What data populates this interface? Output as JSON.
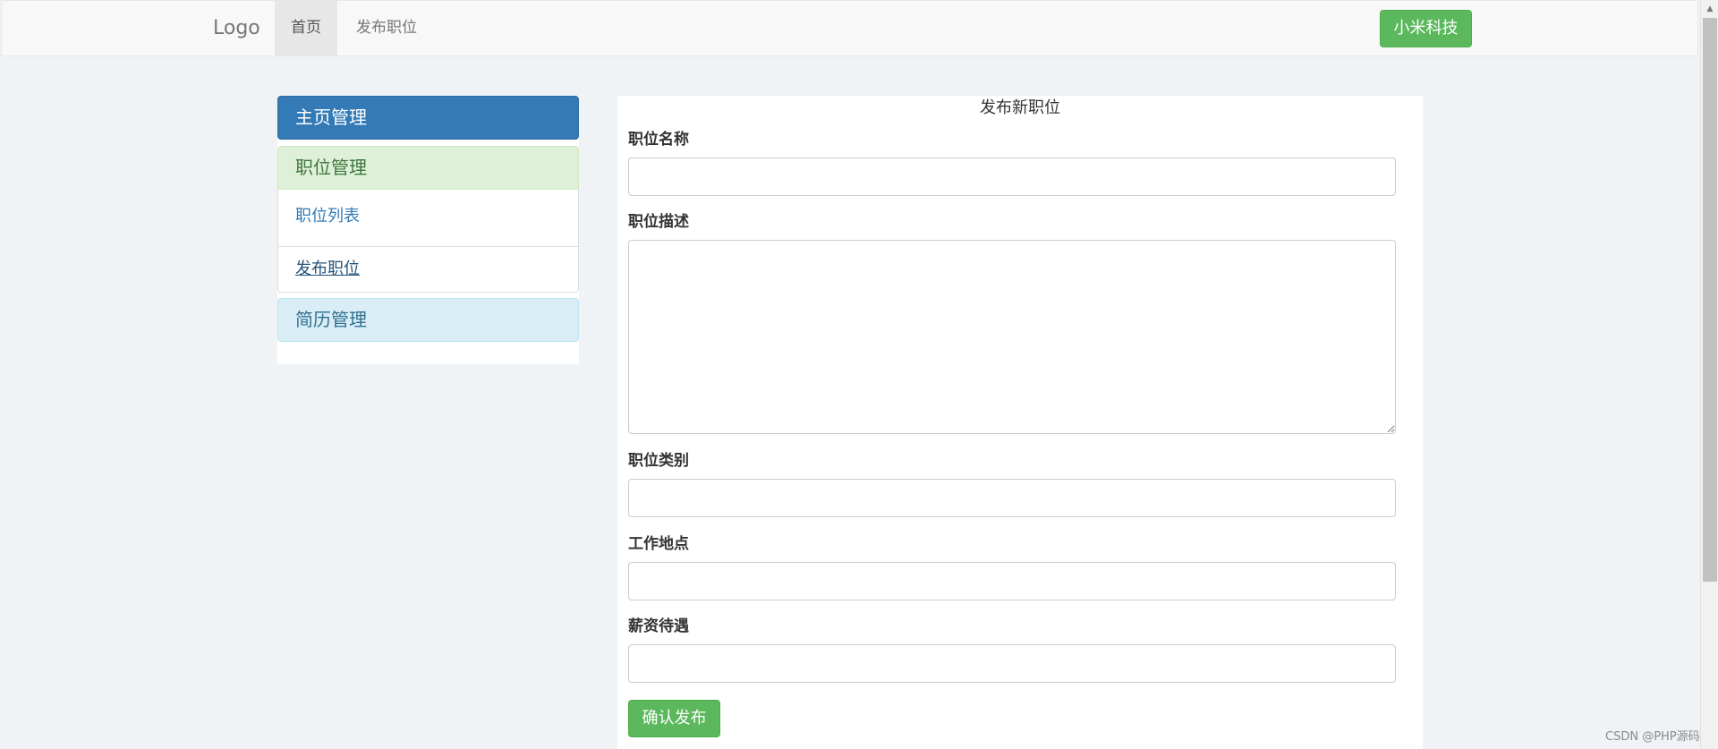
{
  "navbar": {
    "brand": "Logo",
    "items": [
      {
        "label": "首页",
        "active": true
      },
      {
        "label": "发布职位",
        "active": false
      }
    ],
    "company_button": "小米科技"
  },
  "sidebar": {
    "panels": [
      {
        "label": "主页管理",
        "items": []
      },
      {
        "label": "职位管理",
        "items": [
          {
            "label": "职位列表"
          },
          {
            "label": "发布职位"
          }
        ]
      },
      {
        "label": "简历管理",
        "items": []
      }
    ]
  },
  "form": {
    "title": "发布新职位",
    "fields": [
      {
        "label": "职位名称",
        "value": ""
      },
      {
        "label": "职位描述",
        "value": ""
      },
      {
        "label": "职位类别",
        "value": ""
      },
      {
        "label": "工作地点",
        "value": ""
      },
      {
        "label": "薪资待遇",
        "value": ""
      }
    ],
    "submit_label": "确认发布"
  },
  "watermark": "CSDN @PHP源码",
  "colors": {
    "primary": "#337ab7",
    "success": "#5cb85c",
    "success_panel": "#dff0d8",
    "info_panel": "#d9edf7",
    "page_bg": "#eff3f6"
  }
}
